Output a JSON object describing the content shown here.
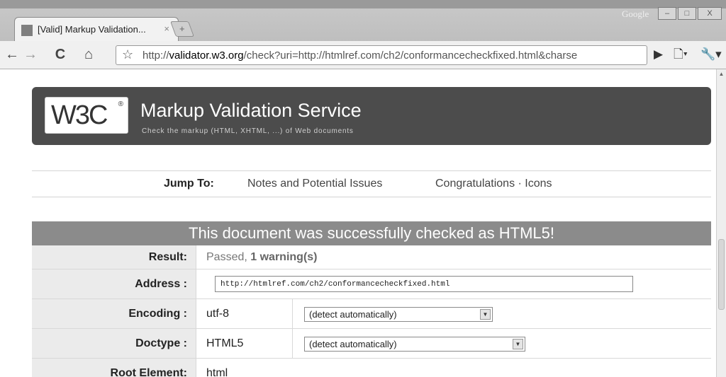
{
  "browser": {
    "tab_title": "[Valid] Markup Validation...",
    "tab_close": "×",
    "new_tab": "+",
    "corner_label": "Google",
    "url_domain": "validator.w3.org",
    "url_prefix": "http://",
    "url_rest": "/check?uri=http://htmlref.com/ch2/conformancecheckfixed.html&charse",
    "icons": [
      "back-icon",
      "forward-icon",
      "reload-icon",
      "home-icon",
      "star-icon",
      "play-icon",
      "page-icon",
      "wrench-icon"
    ]
  },
  "banner": {
    "logo_text": "W3C",
    "logo_mark": "®",
    "title": "Markup Validation Service",
    "subtitle": "Check the markup (HTML, XHTML, ...) of Web documents"
  },
  "jump": {
    "label": "Jump To:",
    "link1": "Notes and Potential Issues",
    "link2": "Congratulations · Icons"
  },
  "results": {
    "header": "This document was successfully checked as HTML5!",
    "result_label": "Result:",
    "result_passed": "Passed,",
    "result_warning": "1 warning(s)",
    "address_label": "Address :",
    "address_value": "http://htmlref.com/ch2/conformancecheckfixed.html",
    "encoding_label": "Encoding :",
    "encoding_value": "utf-8",
    "encoding_select": "(detect automatically)",
    "doctype_label": "Doctype :",
    "doctype_value": "HTML5",
    "doctype_select": "(detect automatically)",
    "root_label": "Root Element:",
    "root_value": "html"
  },
  "colors": {
    "banner_bg": "#4c4c4c",
    "results_header_bg": "#8b8b8b",
    "label_cell_bg": "#ebebeb"
  }
}
